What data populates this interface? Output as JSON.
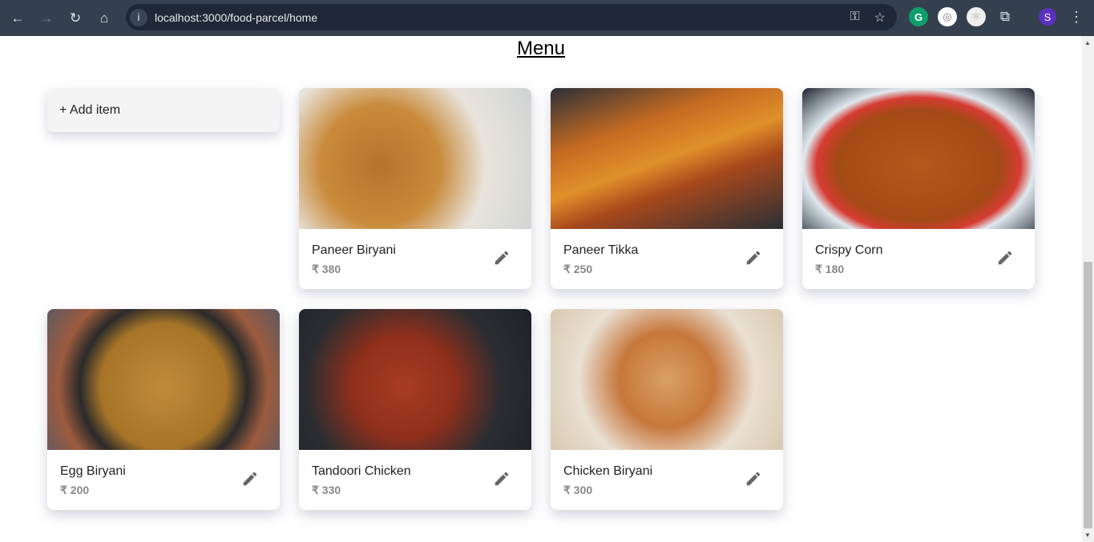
{
  "browser": {
    "url": "localhost:3000/food-parcel/home",
    "profile_initial": "S"
  },
  "page": {
    "title": "Menu",
    "add_label": "+ Add item"
  },
  "items": [
    {
      "name": "Paneer Biryani",
      "price": "₹ 380"
    },
    {
      "name": "Paneer Tikka",
      "price": "₹ 250"
    },
    {
      "name": "Crispy Corn",
      "price": "₹ 180"
    },
    {
      "name": "Egg Biryani",
      "price": "₹ 200"
    },
    {
      "name": "Tandoori Chicken",
      "price": "₹ 330"
    },
    {
      "name": "Chicken Biryani",
      "price": "₹ 300"
    }
  ]
}
